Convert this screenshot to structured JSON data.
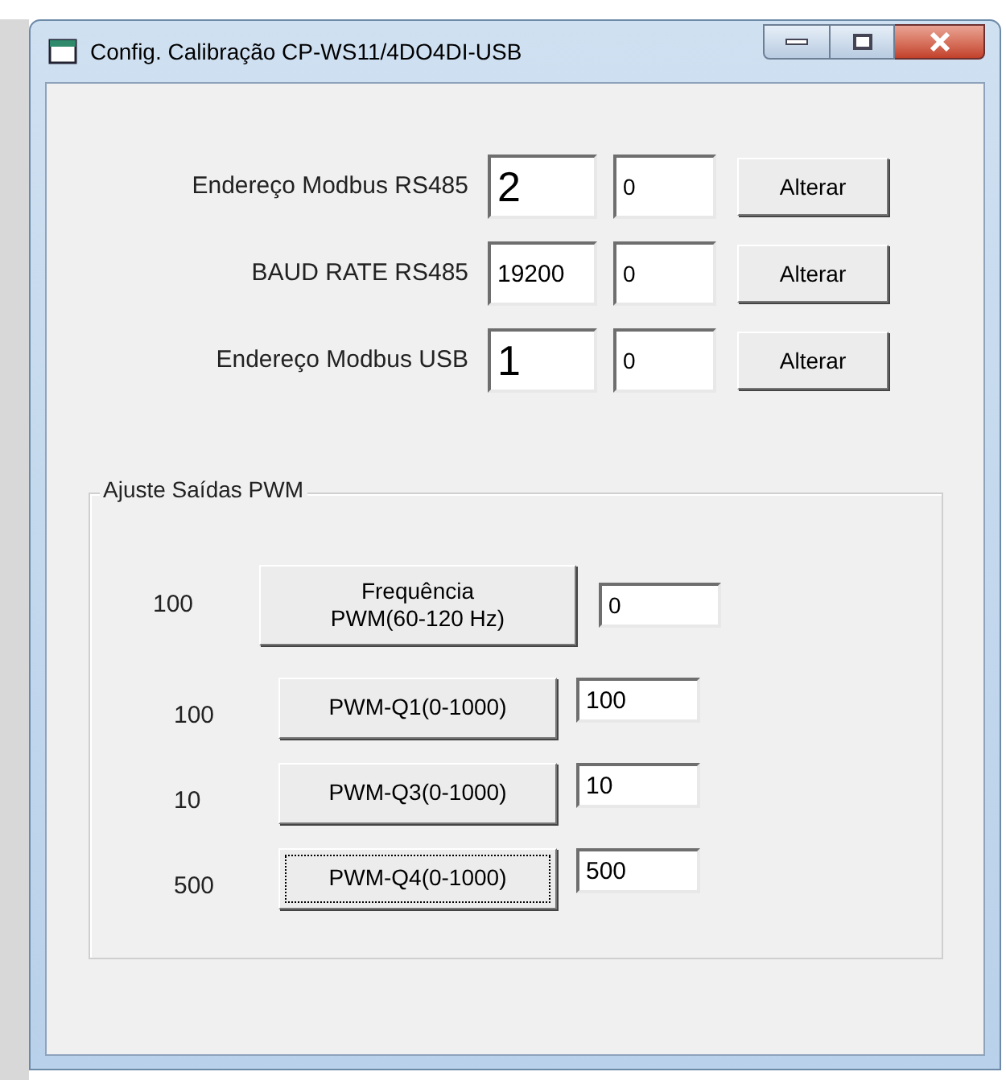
{
  "window": {
    "title": "Config. Calibração CP-WS11/4DO4DI-USB"
  },
  "settings": [
    {
      "label": "Endereço Modbus RS485",
      "value": "2",
      "large": true,
      "new_value": "0",
      "button": "Alterar"
    },
    {
      "label": "BAUD RATE RS485",
      "value": "19200",
      "large": false,
      "new_value": "0",
      "button": "Alterar"
    },
    {
      "label": "Endereço Modbus USB",
      "value": "1",
      "large": true,
      "new_value": "0",
      "button": "Alterar"
    }
  ],
  "pwm_group": {
    "title": "Ajuste Saídas PWM",
    "frequency": {
      "reading": "100",
      "button_lines": [
        "Frequência",
        "PWM(60-120 Hz)"
      ],
      "value": "0",
      "focused": false
    },
    "outputs": [
      {
        "reading": "100",
        "button": "PWM-Q1(0-1000)",
        "value": "100",
        "focused": false
      },
      {
        "reading": "10",
        "button": "PWM-Q3(0-1000)",
        "value": "10",
        "focused": false
      },
      {
        "reading": "500",
        "button": "PWM-Q4(0-1000)",
        "value": "500",
        "focused": true
      }
    ]
  }
}
